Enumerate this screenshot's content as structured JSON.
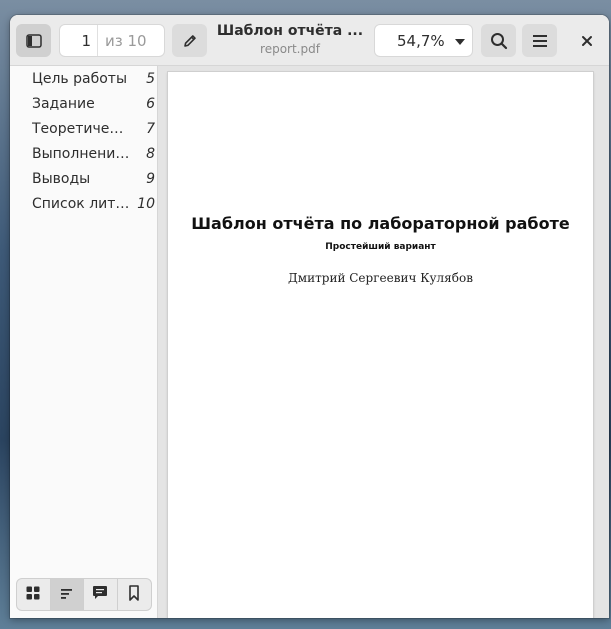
{
  "header": {
    "page_number": "1",
    "page_total": "из 10",
    "title": "Шаблон отчёта ...",
    "subtitle": "report.pdf",
    "zoom": "54,7%",
    "close_label": "×"
  },
  "outline": [
    {
      "label": "Цель работы",
      "page": "5"
    },
    {
      "label": "Задание",
      "page": "6"
    },
    {
      "label": "Теоретичес…",
      "page": "7"
    },
    {
      "label": "Выполнение…",
      "page": "8"
    },
    {
      "label": "Выводы",
      "page": "9"
    },
    {
      "label": "Список лите…",
      "page": "10"
    }
  ],
  "document": {
    "title": "Шаблон отчёта по лабораторной работе",
    "subtitle": "Простейший вариант",
    "author": "Дмитрий Сергеевич Кулябов"
  },
  "icons": {
    "sidebar_toggle": "sidebar-icon",
    "edit": "pencil-icon",
    "zoom_dropdown": "chevron-down-icon",
    "search": "search-icon",
    "menu": "hamburger-icon",
    "close": "close-icon",
    "thumbnails": "grid-icon",
    "outline": "outline-icon",
    "annotations": "comment-icon",
    "bookmarks": "bookmark-icon"
  }
}
